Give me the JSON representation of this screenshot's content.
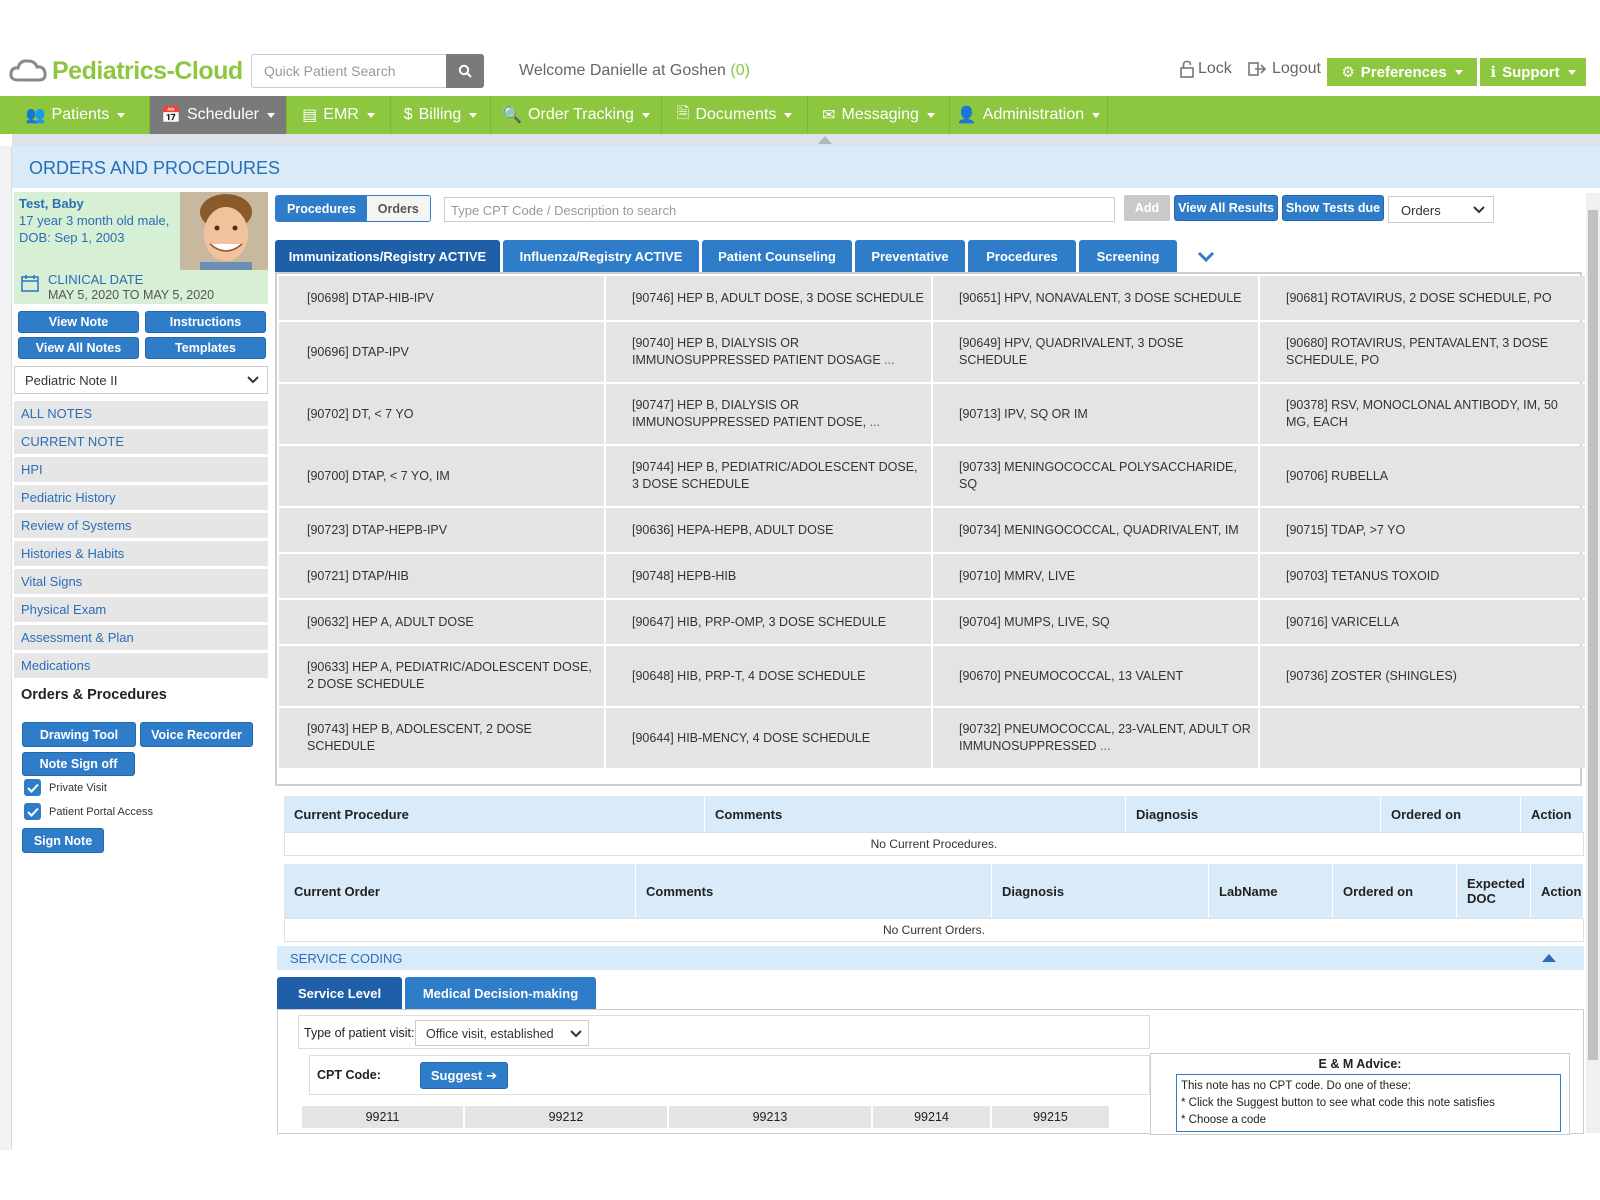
{
  "app": {
    "logo_text": "Pediatrics-Cloud",
    "search_placeholder": "Quick Patient Search",
    "welcome": "Welcome Danielle at Goshen",
    "welcome_count": "(0)",
    "lock": "Lock",
    "logout": "Logout",
    "preferences": "Preferences",
    "support": "Support",
    "brand_color": "#8dc63f",
    "accent_color": "#2f7dc9"
  },
  "nav": [
    {
      "label": "Patients",
      "icon": "users-icon"
    },
    {
      "label": "Scheduler",
      "icon": "calendar-icon"
    },
    {
      "label": "EMR",
      "icon": "emr-icon"
    },
    {
      "label": "Billing",
      "icon": "dollar-icon"
    },
    {
      "label": "Order Tracking",
      "icon": "search-icon"
    },
    {
      "label": "Documents",
      "icon": "document-icon"
    },
    {
      "label": "Messaging",
      "icon": "envelope-icon"
    },
    {
      "label": "Administration",
      "icon": "user-icon"
    }
  ],
  "page_title": "ORDERS AND PROCEDURES",
  "patient": {
    "name": "Test, Baby",
    "age_line": "17 year 3 month old male,",
    "dob_line": "DOB: Sep 1, 2003",
    "clinical_label": "CLINICAL DATE",
    "clinical_dates": "MAY 5, 2020 TO MAY 5, 2020"
  },
  "left_buttons": {
    "view_note": "View Note",
    "instructions": "Instructions",
    "view_all_notes": "View All Notes",
    "templates": "Templates",
    "note_type": "Pediatric Note II",
    "drawing_tool": "Drawing Tool",
    "voice_recorder": "Voice Recorder",
    "note_sign_off": "Note Sign off",
    "private_visit": "Private Visit",
    "portal_access": "Patient Portal Access",
    "sign_note": "Sign Note"
  },
  "side_nav": [
    "ALL NOTES",
    "CURRENT NOTE",
    "HPI",
    "Pediatric History",
    "Review of Systems",
    "Histories & Habits",
    "Vital Signs",
    "Physical Exam",
    "Assessment & Plan",
    "Medications",
    "Orders & Procedures"
  ],
  "toolbar": {
    "procedures": "Procedures",
    "orders": "Orders",
    "cpt_placeholder": "Type CPT Code / Description to search",
    "add": "Add",
    "view_all_results": "View All Results",
    "show_tests_due": "Show Tests due",
    "filter_value": "Orders"
  },
  "tabs": [
    "Immunizations/Registry ACTIVE",
    "Influenza/Registry ACTIVE",
    "Patient Counseling",
    "Preventative",
    "Procedures",
    "Screening"
  ],
  "grid": [
    [
      "[90698] DTAP-HIB-IPV",
      "[90746] HEP B, ADULT DOSE, 3 DOSE SCHEDULE",
      "[90651] HPV, NONAVALENT, 3 DOSE SCHEDULE",
      "[90681] ROTAVIRUS, 2 DOSE SCHEDULE, PO"
    ],
    [
      "[90696] DTAP-IPV",
      "[90740] HEP B, DIALYSIS OR IMMUNOSUPPRESSED PATIENT DOSAGE",
      "[90649] HPV, QUADRIVALENT, 3 DOSE SCHEDULE",
      "[90680] ROTAVIRUS, PENTAVALENT, 3 DOSE SCHEDULE, PO"
    ],
    [
      "[90702] DT, < 7 YO",
      "[90747] HEP B, DIALYSIS OR IMMUNOSUPPRESSED PATIENT DOSE,",
      "[90713] IPV, SQ OR IM",
      "[90378] RSV, MONOCLONAL ANTIBODY, IM, 50 MG, EACH"
    ],
    [
      "[90700] DTAP, < 7 YO, IM",
      "[90744] HEP B, PEDIATRIC/ADOLESCENT DOSE, 3 DOSE SCHEDULE",
      "[90733] MENINGOCOCCAL POLYSACCHARIDE, SQ",
      "[90706] RUBELLA"
    ],
    [
      "[90723] DTAP-HEPB-IPV",
      "[90636] HEPA-HEPB, ADULT DOSE",
      "[90734] MENINGOCOCCAL, QUADRIVALENT, IM",
      "[90715] TDAP, >7 YO"
    ],
    [
      "[90721] DTAP/HIB",
      "[90748] HEPB-HIB",
      "[90710] MMRV, LIVE",
      "[90703] TETANUS TOXOID"
    ],
    [
      "[90632] HEP A, ADULT DOSE",
      "[90647] HIB, PRP-OMP, 3 DOSE SCHEDULE",
      "[90704] MUMPS, LIVE, SQ",
      "[90716] VARICELLA"
    ],
    [
      "[90633] HEP A, PEDIATRIC/ADOLESCENT DOSE, 2 DOSE SCHEDULE",
      "[90648] HIB, PRP-T, 4 DOSE SCHEDULE",
      "[90670] PNEUMOCOCCAL, 13 VALENT",
      "[90736] ZOSTER (SHINGLES)"
    ],
    [
      "[90743] HEP B, ADOLESCENT, 2 DOSE SCHEDULE",
      "[90644] HIB-MENCY, 4 DOSE SCHEDULE",
      "[90732] PNEUMOCOCCAL, 23-VALENT, ADULT OR IMMUNOSUPPRESSED",
      ""
    ]
  ],
  "ellipsis": "...",
  "procedures_table": {
    "headers": [
      "Current Procedure",
      "Comments",
      "Diagnosis",
      "Ordered on",
      "Action"
    ],
    "empty": "No Current Procedures."
  },
  "orders_table": {
    "headers": [
      "Current Order",
      "Comments",
      "Diagnosis",
      "LabName",
      "Ordered on",
      "Expected DOC",
      "Action"
    ],
    "empty": "No Current Orders."
  },
  "service_coding": {
    "title": "SERVICE CODING",
    "tab_service_level": "Service Level",
    "tab_mdm": "Medical Decision-making",
    "visit_label": "Type of patient visit:",
    "visit_value": "Office visit, established",
    "cpt_label": "CPT Code:",
    "suggest": "Suggest",
    "codes": [
      "99211",
      "99212",
      "99213",
      "99214",
      "99215"
    ],
    "em_title": "E & M Advice:",
    "em_lines": [
      "This note has no CPT code. Do one of these:",
      "* Click the Suggest button to see what code this note satisfies",
      "* Choose a code"
    ]
  }
}
